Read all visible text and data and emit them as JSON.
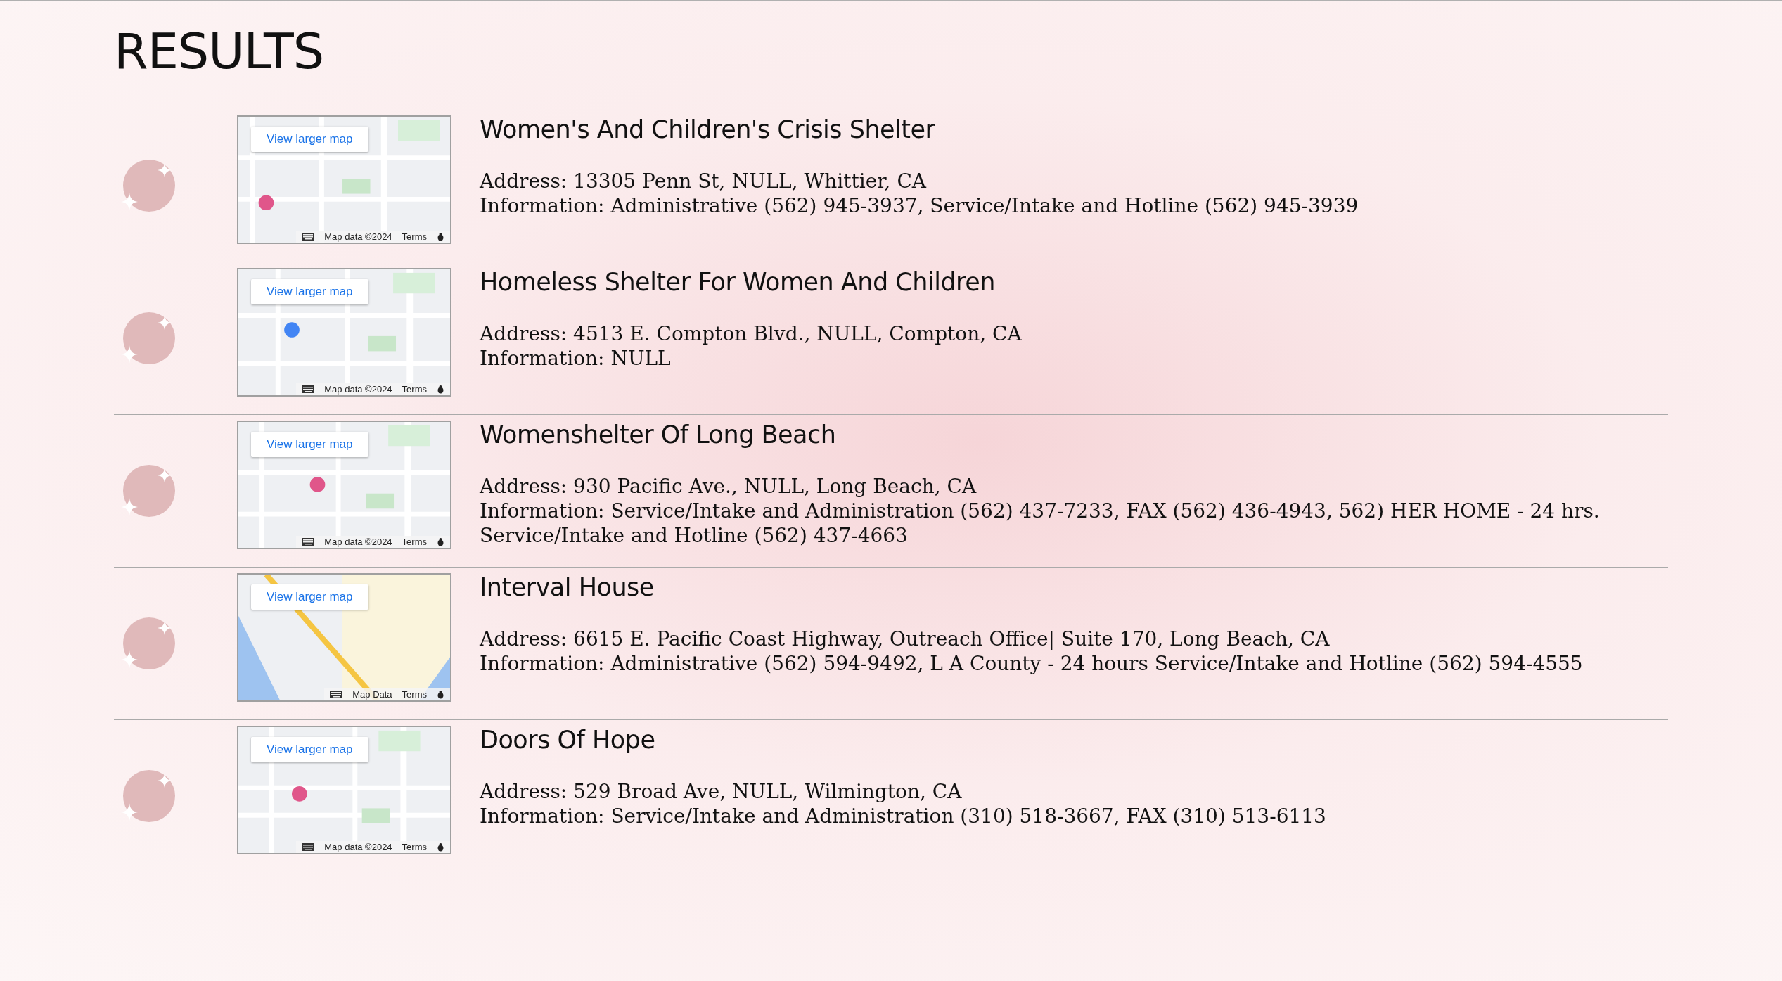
{
  "heading": "RESULTS",
  "results": [
    {
      "name": "Women's And Children's Crisis Shelter",
      "address": "Address: 13305 Penn St, NULL, Whittier, CA",
      "information": "Information: Administrative (562) 945-3937, Service/Intake and Hotline (562) 945-3939",
      "map": {
        "link": "View larger map",
        "attribution": "Map data ©2024",
        "terms": "Terms"
      }
    },
    {
      "name": "Homeless Shelter For Women And Children",
      "address": "Address: 4513 E. Compton Blvd., NULL, Compton, CA",
      "information": "Information: NULL",
      "map": {
        "link": "View larger map",
        "attribution": "Map data ©2024",
        "terms": "Terms"
      }
    },
    {
      "name": "Womenshelter Of Long Beach",
      "address": "Address: 930 Pacific Ave., NULL, Long Beach, CA",
      "information": "Information: Service/Intake and Administration (562) 437-7233, FAX (562) 436-4943, 562) HER HOME - 24 hrs. Service/Intake and Hotline (562) 437-4663",
      "map": {
        "link": "View larger map",
        "attribution": "Map data ©2024",
        "terms": "Terms"
      }
    },
    {
      "name": "Interval House",
      "address": "Address: 6615 E. Pacific Coast Highway, Outreach Office| Suite 170, Long Beach, CA",
      "information": "Information: Administrative (562) 594-9492, L A County - 24 hours Service/Intake and Hotline (562) 594-4555",
      "map": {
        "link": "View larger map",
        "attribution": "Map Data",
        "terms": "Terms"
      }
    },
    {
      "name": "Doors Of Hope",
      "address": "Address: 529 Broad Ave, NULL, Wilmington, CA",
      "information": "Information: Service/Intake and Administration (310) 518-3667, FAX (310) 513-6113",
      "map": {
        "link": "View larger map",
        "attribution": "Map data ©2024",
        "terms": "Terms"
      }
    }
  ]
}
